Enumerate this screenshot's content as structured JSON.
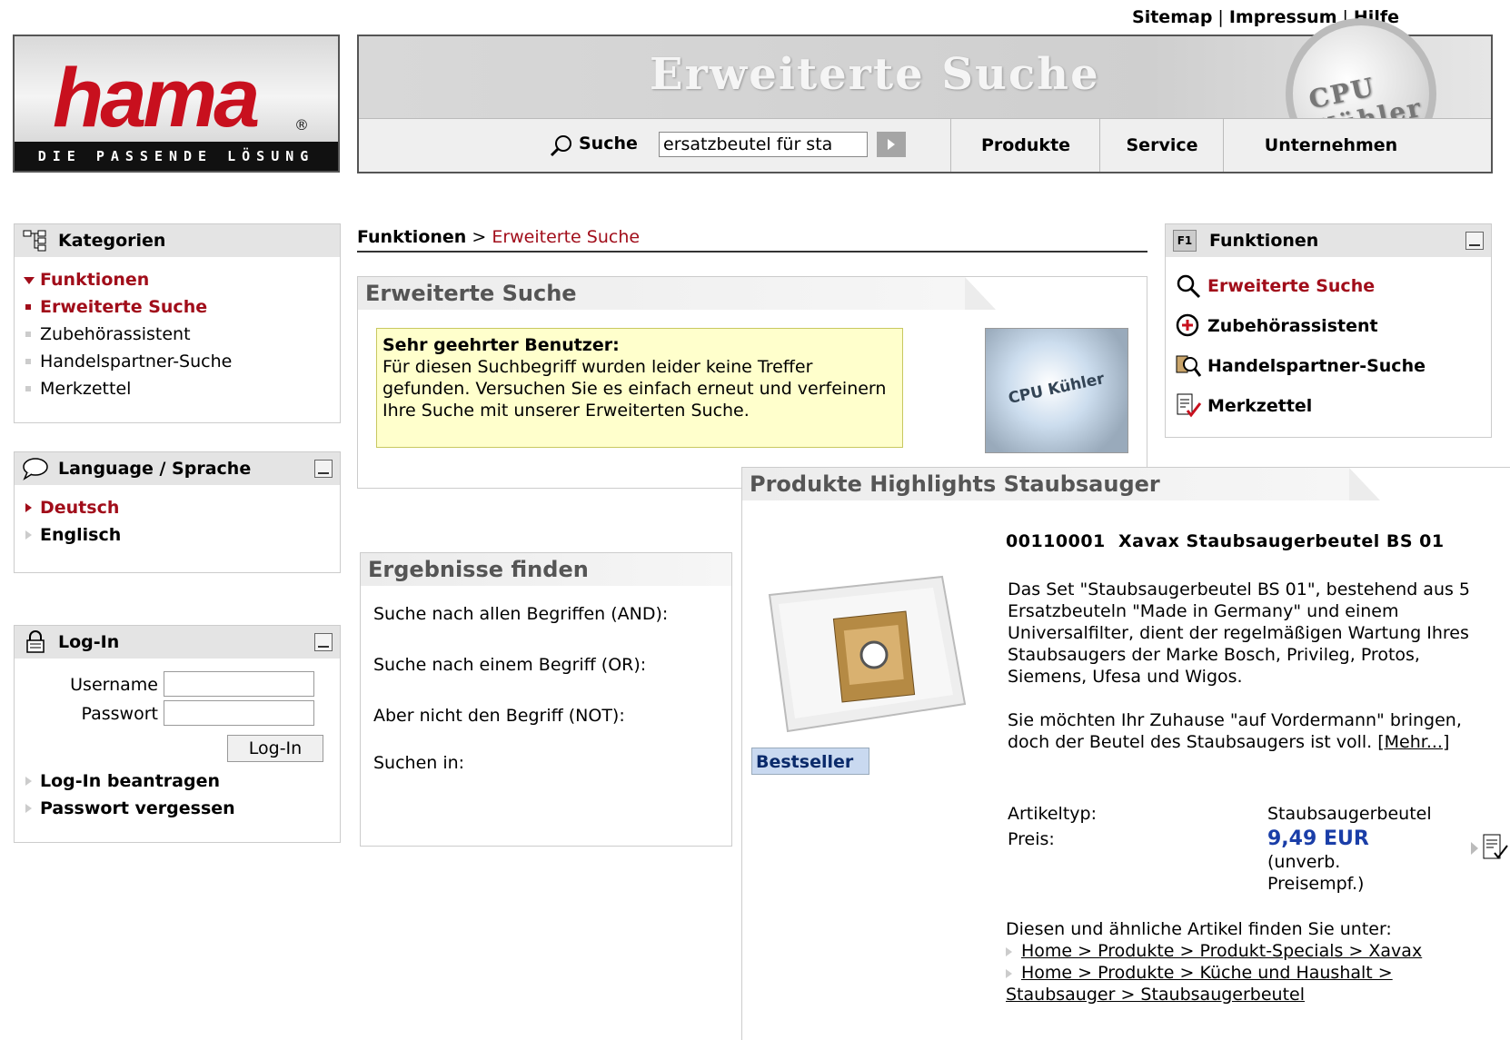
{
  "top_links": [
    "Sitemap",
    "Impressum",
    "Hilfe"
  ],
  "logo": {
    "brand": "hama",
    "reg": "®",
    "tagline": "DIE PASSENDE LÖSUNG"
  },
  "header": {
    "banner_title": "Erweiterte Suche",
    "banner_image_text": "CPU Kühler",
    "search_label": "Suche",
    "search_value": "ersatzbeutel für sta",
    "nav": [
      "Produkte",
      "Service",
      "Unternehmen"
    ]
  },
  "categories": {
    "title": "Kategorien",
    "items": [
      {
        "label": "Funktionen",
        "state": "open"
      },
      {
        "label": "Erweiterte Suche",
        "state": "selected"
      },
      {
        "label": "Zubehörassistent",
        "state": "normal"
      },
      {
        "label": "Handelspartner-Suche",
        "state": "normal"
      },
      {
        "label": "Merkzettel",
        "state": "normal"
      }
    ]
  },
  "language": {
    "title": "Language / Sprache",
    "items": [
      {
        "label": "Deutsch",
        "selected": true
      },
      {
        "label": "Englisch",
        "selected": false
      }
    ]
  },
  "login": {
    "title": "Log-In",
    "username_label": "Username",
    "password_label": "Passwort",
    "button_label": "Log-In",
    "links": [
      "Log-In beantragen",
      "Passwort vergessen"
    ]
  },
  "breadcrumb": {
    "parent": "Funktionen",
    "sep": ">",
    "current": "Erweiterte Suche"
  },
  "search_panel": {
    "title": "Erweiterte Suche",
    "notice_title": "Sehr geehrter Benutzer:",
    "notice_text": "Für diesen Suchbegriff wurden leider keine Treffer gefunden. Versuchen Sie es einfach erneut und verfeinern Ihre Suche mit unserer Erweiterten Suche.",
    "image_text": "CPU Kühler"
  },
  "results_panel": {
    "title": "Ergebnisse finden",
    "rows": [
      "Suche nach allen Begriffen (AND):",
      "Suche nach einem Begriff (OR):",
      "Aber nicht den Begriff (NOT):",
      "Suchen in:"
    ]
  },
  "functions": {
    "title": "Funktionen",
    "header_icon": "F1",
    "items": [
      {
        "label": "Erweiterte Suche",
        "icon": "magnifier-icon",
        "selected": true
      },
      {
        "label": "Zubehörassistent",
        "icon": "plus-circle-icon",
        "selected": false
      },
      {
        "label": "Handelspartner-Suche",
        "icon": "partner-search-icon",
        "selected": false
      },
      {
        "label": "Merkzettel",
        "icon": "notepad-icon",
        "selected": false
      }
    ]
  },
  "highlights": {
    "title": "Produkte Highlights Staubsauger",
    "badge": "Bestseller",
    "article_no": "00110001",
    "product_name": "Xavax Staubsaugerbeutel BS 01",
    "desc1": "Das Set \"Staubsaugerbeutel BS 01\", bestehend aus 5 Ersatzbeuteln \"Made in Germany\" und einem Universalfilter, dient der regelmäßigen Wartung Ihres Staubsaugers der Marke Bosch, Privileg, Protos, Siemens, Ufesa und Wigos.",
    "desc2": "Sie möchten Ihr Zuhause \"auf Vordermann\" bringen, doch der Beutel des Staubsaugers ist voll.",
    "more": "[Mehr...]",
    "type_label": "Artikeltyp:",
    "type_value": "Staubsaugerbeutel",
    "price_label": "Preis:",
    "price_value": "9,49  EUR",
    "price_note": "(unverb. Preisempf.)",
    "see_also": "Diesen und ähnliche Artikel finden Sie unter:",
    "path1": "Home > Produkte > Produkt-Specials > Xavax",
    "path2a": "Home > Produkte > Küche und Haushalt >",
    "path2b": "Staubsauger > Staubsaugerbeutel"
  },
  "colors": {
    "accent_red": "#a10d1a",
    "price_blue": "#1a3ea8",
    "notice_bg": "#ffffcc"
  }
}
